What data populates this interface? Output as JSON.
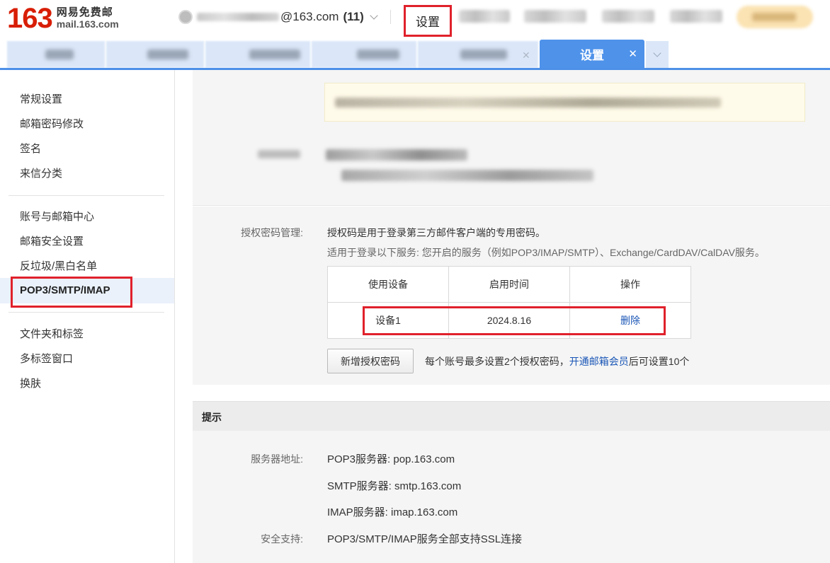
{
  "header": {
    "logo_number": "163",
    "logo_cn": "网易免费邮",
    "logo_en": "mail.163.com",
    "account_domain": "@163.com",
    "account_count": "(11)",
    "nav_settings": "设置"
  },
  "tabs": {
    "active_label": "设置",
    "close_symbol": "✕"
  },
  "sidebar": {
    "group1": [
      "常规设置",
      "邮箱密码修改",
      "签名",
      "来信分类"
    ],
    "group2": [
      "账号与邮箱中心",
      "邮箱安全设置",
      "反垃圾/黑白名单",
      "POP3/SMTP/IMAP"
    ],
    "group3": [
      "文件夹和标签",
      "多标签窗口",
      "换肤"
    ],
    "active": "POP3/SMTP/IMAP"
  },
  "auth": {
    "label": "授权密码管理:",
    "desc1": "授权码是用于登录第三方邮件客户端的专用密码。",
    "desc2": "适用于登录以下服务: 您开启的服务（例如POP3/IMAP/SMTP）、Exchange/CardDAV/CalDAV服务。",
    "table": {
      "headers": [
        "使用设备",
        "启用时间",
        "操作"
      ],
      "rows": [
        {
          "device": "设备1",
          "time": "2024.8.16",
          "action": "删除"
        }
      ]
    },
    "add_button": "新增授权密码",
    "note_prefix": "每个账号最多设置2个授权密码，",
    "note_link": "开通邮箱会员",
    "note_suffix": "后可设置10个"
  },
  "tips": {
    "title": "提示",
    "server_label": "服务器地址:",
    "pop3": "POP3服务器: pop.163.com",
    "smtp": "SMTP服务器: smtp.163.com",
    "imap": "IMAP服务器: imap.163.com",
    "ssl_label": "安全支持:",
    "ssl_value": "POP3/SMTP/IMAP服务全部支持SSL连接"
  },
  "colors": {
    "brand_red": "#d81e06",
    "highlight_red": "#e0212b",
    "tab_blue": "#4e92ea",
    "link_blue": "#1a56b6"
  }
}
